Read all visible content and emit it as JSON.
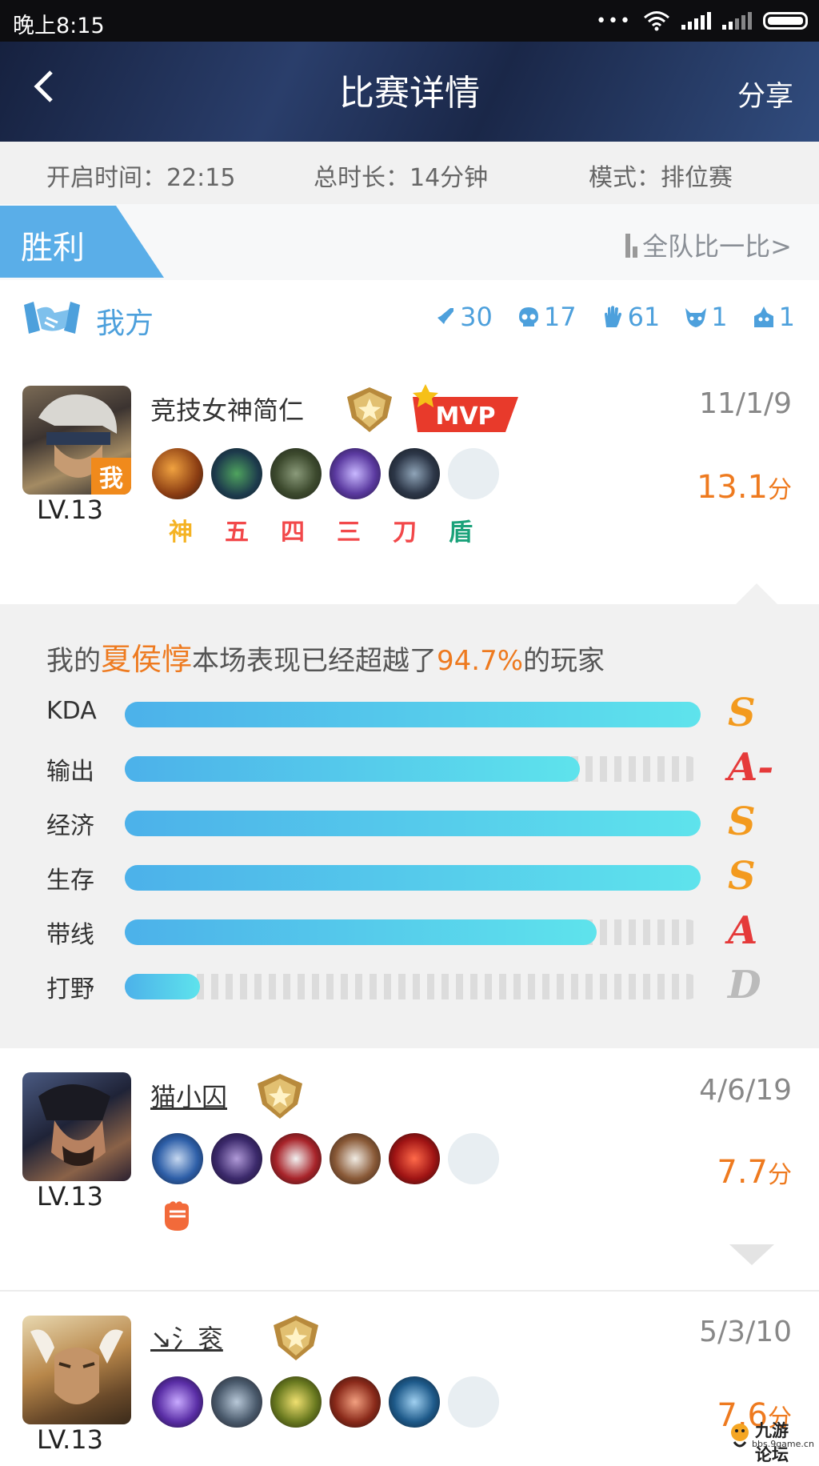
{
  "status_bar": {
    "time": "晚上8:15",
    "more": "•••"
  },
  "header": {
    "title": "比赛详情",
    "share": "分享",
    "back": "<"
  },
  "match_info": {
    "start_time": "开启时间：22:15",
    "duration": "总时长：14分钟",
    "mode": "模式：排位赛"
  },
  "result": {
    "label": "胜利",
    "compare": "全队比一比>"
  },
  "team": {
    "name": "我方",
    "stats": [
      {
        "icon": "sword-icon",
        "value": "30"
      },
      {
        "icon": "skull-icon",
        "value": "17"
      },
      {
        "icon": "hand-icon",
        "value": "61"
      },
      {
        "icon": "demon-icon",
        "value": "1"
      },
      {
        "icon": "tower-icon",
        "value": "1"
      }
    ]
  },
  "players": [
    {
      "name": "竞技女神简仁",
      "level": "LV.13",
      "kda": "11/1/9",
      "score": "13.1",
      "score_unit": "分",
      "me_tag": "我",
      "mvp": "MVP",
      "badges": [
        "神",
        "五",
        "四",
        "三",
        "刀",
        "盾"
      ]
    },
    {
      "name": "猫小囚",
      "level": "LV.13",
      "kda": "4/6/19",
      "score": "7.7",
      "score_unit": "分"
    },
    {
      "name": "↘氵衮",
      "level": "LV.13",
      "kda": "5/3/10",
      "score": "7.6",
      "score_unit": "分"
    }
  ],
  "performance": {
    "summary_prefix": "我的",
    "hero": "夏侯惇",
    "summary_middle": "本场表现已经超越了",
    "percent": "94.7%",
    "summary_suffix": "的玩家",
    "rows": [
      {
        "label": "KDA",
        "value": 1.0,
        "grade": "S"
      },
      {
        "label": "输出",
        "value": 0.79,
        "grade": "A-"
      },
      {
        "label": "经济",
        "value": 1.0,
        "grade": "S"
      },
      {
        "label": "生存",
        "value": 1.0,
        "grade": "S"
      },
      {
        "label": "带线",
        "value": 0.82,
        "grade": "A"
      },
      {
        "label": "打野",
        "value": 0.13,
        "grade": "D"
      }
    ]
  },
  "colors": {
    "accent_blue": "#4da0dc",
    "win_tab": "#5aaee8",
    "score_orange": "#ee7a1f",
    "grade_red": "#e53a3a",
    "grade_orange": "#f39a1e",
    "grade_grey": "#bbbbbb"
  },
  "watermark": {
    "title": "九游论坛",
    "url": "bbs.9game.cn"
  }
}
